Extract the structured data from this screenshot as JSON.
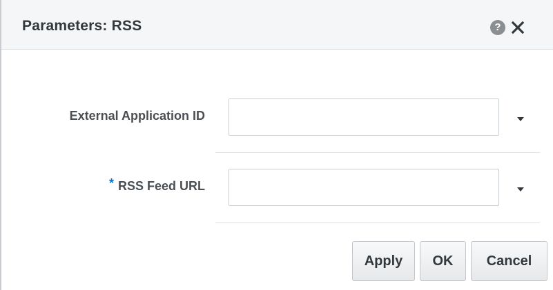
{
  "dialog": {
    "title": "Parameters: RSS",
    "help_icon": "question-circle-icon",
    "help_glyph": "?",
    "close_icon": "close-icon"
  },
  "form": {
    "fields": [
      {
        "label": "External Application ID",
        "required": false,
        "value": "",
        "has_dropdown": true
      },
      {
        "label": "RSS Feed URL",
        "required": true,
        "required_marker": "*",
        "value": "",
        "has_dropdown": true
      }
    ]
  },
  "buttons": {
    "apply": "Apply",
    "ok": "OK",
    "cancel": "Cancel"
  },
  "colors": {
    "required_marker": "#0572ce",
    "title_text": "#33383c",
    "header_bg": "#f5f6f7"
  }
}
